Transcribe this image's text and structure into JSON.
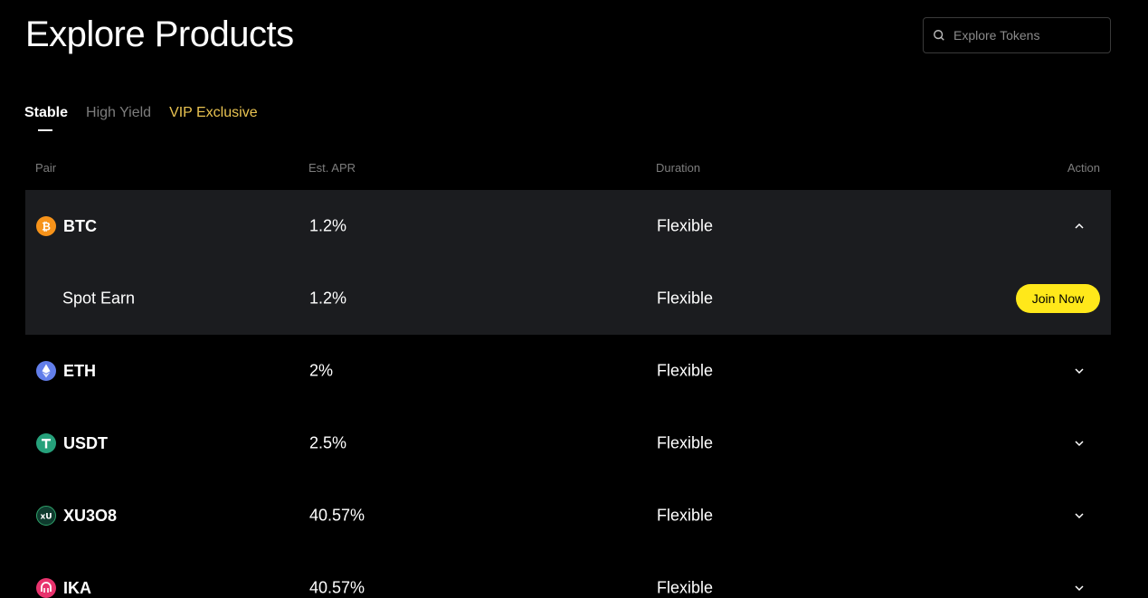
{
  "header": {
    "title": "Explore Products",
    "search_placeholder": "Explore Tokens"
  },
  "tabs": [
    {
      "label": "Stable",
      "state": "active"
    },
    {
      "label": "High Yield",
      "state": "inactive"
    },
    {
      "label": "VIP Exclusive",
      "state": "highlight"
    }
  ],
  "table": {
    "columns": [
      "Pair",
      "Est. APR",
      "Duration",
      "Action"
    ],
    "rows": [
      {
        "coin": "BTC",
        "icon": "btc-icon",
        "icon_color": "#f7931a",
        "apr": "1.2%",
        "duration": "Flexible",
        "expanded": true,
        "sub": {
          "name": "Spot Earn",
          "apr": "1.2%",
          "duration": "Flexible",
          "action": "Join Now"
        }
      },
      {
        "coin": "ETH",
        "icon": "eth-icon",
        "icon_color": "#627eea",
        "apr": "2%",
        "duration": "Flexible",
        "expanded": false
      },
      {
        "coin": "USDT",
        "icon": "usdt-icon",
        "icon_color": "#26a17b",
        "apr": "2.5%",
        "duration": "Flexible",
        "expanded": false
      },
      {
        "coin": "XU3O8",
        "icon": "xu3o8-icon",
        "icon_color": "#0f3b2e",
        "apr": "40.57%",
        "duration": "Flexible",
        "expanded": false
      },
      {
        "coin": "IKA",
        "icon": "ika-icon",
        "icon_color": "#e8336d",
        "apr": "40.57%",
        "duration": "Flexible",
        "expanded": false
      }
    ]
  },
  "colors": {
    "accent_yellow": "#ffe81a",
    "vip_gold": "#e9c351",
    "expanded_bg": "#1b1c1f"
  }
}
